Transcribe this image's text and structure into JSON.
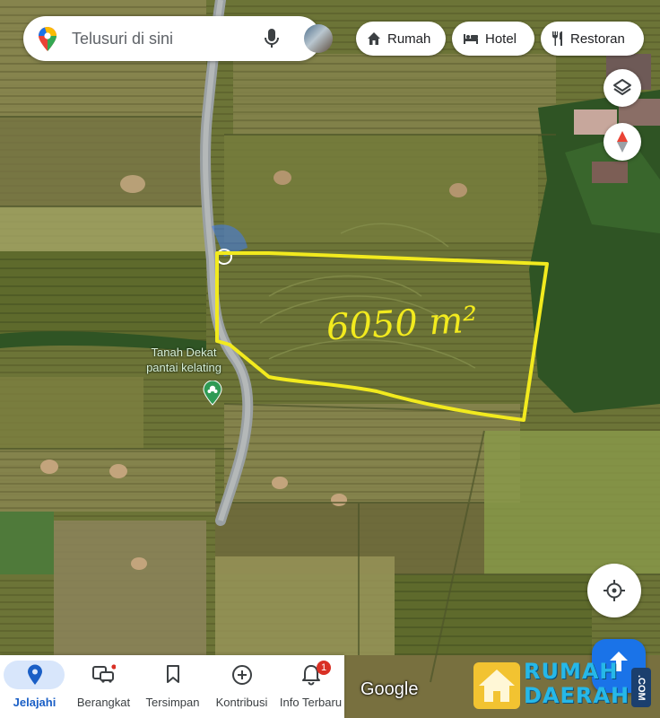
{
  "search": {
    "placeholder": "Telusuri di sini",
    "icons": {
      "logo": "maps-pin-logo",
      "mic": "microphone-icon",
      "avatar": "profile-avatar"
    }
  },
  "chips": [
    {
      "label": "Rumah",
      "icon": "home-icon"
    },
    {
      "label": "Hotel",
      "icon": "bed-icon"
    },
    {
      "label": "Restoran",
      "icon": "fork-knife-icon"
    }
  ],
  "map": {
    "annotation": "6050 m²",
    "poi_label_line1": "Tanah Dekat",
    "poi_label_line2": "pantai kelating",
    "poi_icon": "park-icon",
    "google_label": "Google",
    "colors": {
      "fields": "#6b7438",
      "plot_outline": "#f2ea1e",
      "road": "#9aa0a3",
      "trees": "#2f5424"
    }
  },
  "controls": {
    "layers": "layers-icon",
    "compass": "compass-icon",
    "my_location": "my-location-icon",
    "directions": "directions-icon"
  },
  "nav": {
    "items": [
      {
        "label": "Jelajahi",
        "icon": "explore-pin-icon",
        "active": true
      },
      {
        "label": "Berangkat",
        "icon": "commute-icon",
        "active": false
      },
      {
        "label": "Tersimpan",
        "icon": "bookmark-icon",
        "active": false
      },
      {
        "label": "Kontribusi",
        "icon": "add-circle-icon",
        "active": false
      },
      {
        "label": "Info Terbaru",
        "icon": "bell-icon",
        "active": false,
        "badge": "1"
      }
    ]
  },
  "watermark": {
    "line1": "RUMAH",
    "line2": "DAERAH",
    "suffix": ".COM"
  }
}
